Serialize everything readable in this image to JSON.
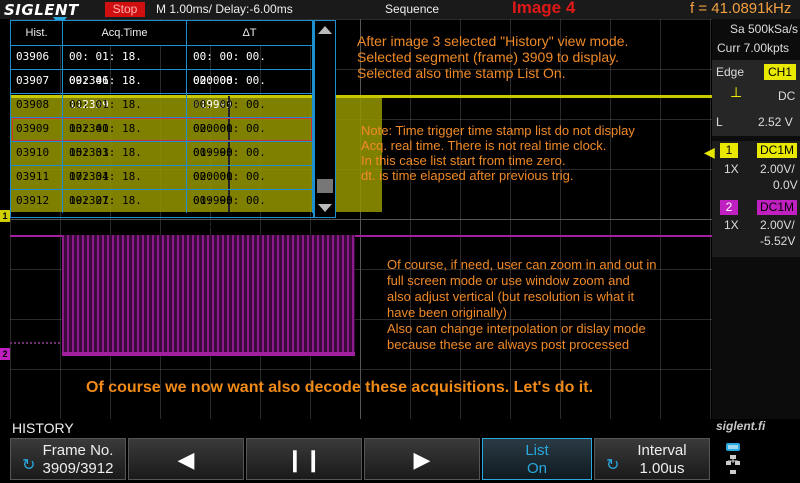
{
  "topbar": {
    "logo": "SIGLENT",
    "run_state": "Stop",
    "timebase": "M 1.00ms/ Delay:-6.00ms",
    "mode": "Sequence",
    "image_title": "Image 4",
    "frequency": "f = 41.0891kHz"
  },
  "history_table": {
    "headers": [
      "Hist.",
      "Acq.Time",
      "ΔT"
    ],
    "rows": [
      [
        "03906",
        "00: 01: 18. 092346",
        "00: 00: 00. 020008"
      ],
      [
        "03907",
        "00: 01: 18. 112339",
        "00: 00: 00. 019993"
      ],
      [
        "03908",
        "00: 01: 18. 132340",
        "00: 00: 00. 020001"
      ],
      [
        "03909",
        "00: 01: 18. 152333",
        "00: 00: 00. 019993"
      ],
      [
        "03910",
        "00: 01: 18. 172334",
        "00: 00: 00. 020001"
      ],
      [
        "03911",
        "00: 01: 18. 192327",
        "00: 00: 00. 019993"
      ],
      [
        "03912",
        "00: 01: 18. 212336",
        "00: 00: 00. 020009"
      ]
    ],
    "selected_frame": "03909"
  },
  "annotations": {
    "note1": "After image 3 selected \"History\" view mode.\nSelected segment (frame) 3909 to display.\nSelected also time stamp List On.",
    "note2": "Note: Time trigger time stamp list do not display\nAcq. real time. There is not real time clock.\nIn this case list start from time zero.\ndt. is time elapsed after previous trig.",
    "note3": "Of course, if need, user can zoom in and out in\nfull screen mode or use window zoom and\nalso adjust vertical (but resolution is what it\nhave been originally)\nAlso can change interpolation or dislay mode\nbecause these are always post processed",
    "conclusion": "Of course we now want also decode these acquisitions. Let's do it.",
    "watermark": "siglent.fi"
  },
  "channel_markers": {
    "ch1": "1",
    "ch2": "2"
  },
  "right_panel": {
    "sample_rate": "Sa 500kSa/s",
    "memory": "Curr 7.00kpts",
    "trigger_type": "Edge",
    "trigger_source": "CH1",
    "trigger_coupling": "DC",
    "trigger_level_label": "L",
    "trigger_level": "2.52 V",
    "ch1": {
      "num": "1",
      "coupling": "DC1M",
      "probe": "1X",
      "scale": "2.00V/",
      "offset": "0.0V"
    },
    "ch2": {
      "num": "2",
      "coupling": "DC1M",
      "probe": "1X",
      "scale": "2.00V/",
      "offset": "-5.52V"
    }
  },
  "menu": {
    "title": "HISTORY",
    "frame_label": "Frame No.",
    "frame_value": "3909/3912",
    "prev_icon": "◀",
    "play_icon": "❙❙",
    "next_icon": "▶",
    "list_label": "List",
    "list_value": "On",
    "interval_label": "Interval",
    "interval_value": "1.00us"
  },
  "colors": {
    "ch1": "#c8c800",
    "ch2": "#a020a0",
    "accent": "#1e90d0",
    "note": "#f08a28"
  }
}
